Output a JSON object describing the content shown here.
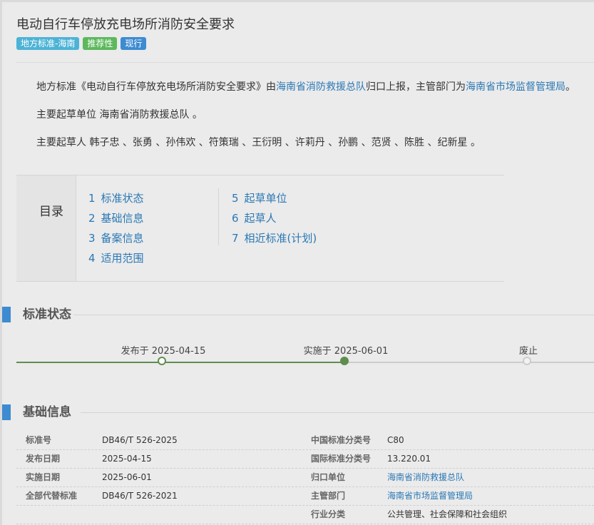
{
  "header": {
    "title": "电动自行车停放充电场所消防安全要求",
    "tags": [
      {
        "label": "地方标准-海南",
        "color": "#4db3d6"
      },
      {
        "label": "推荐性",
        "color": "#5cb85c"
      },
      {
        "label": "现行",
        "color": "#3d8bd1"
      }
    ]
  },
  "intro": {
    "line1_prefix": "地方标准《电动自行车停放充电场所消防安全要求》由",
    "line1_link1": "海南省消防救援总队",
    "line1_mid": "归口上报，主管部门为",
    "line1_link2": "海南省市场监督管理局",
    "line1_suffix": "。",
    "line2": "主要起草单位 海南省消防救援总队 。",
    "line3": "主要起草人 韩子忠 、张勇 、孙伟欢 、符策瑞 、王衍明 、许莉丹 、孙鹏 、范贤 、陈胜 、纪新星 。"
  },
  "toc": {
    "title": "目录",
    "left": [
      {
        "num": "1",
        "label": "标准状态"
      },
      {
        "num": "2",
        "label": "基础信息"
      },
      {
        "num": "3",
        "label": "备案信息"
      },
      {
        "num": "4",
        "label": "适用范围"
      }
    ],
    "right": [
      {
        "num": "5",
        "label": "起草单位"
      },
      {
        "num": "6",
        "label": "起草人"
      },
      {
        "num": "7",
        "label": "相近标准(计划)"
      }
    ]
  },
  "status": {
    "section_title": "标准状态",
    "timeline": [
      {
        "label": "发布于 2025-04-15",
        "state": "done"
      },
      {
        "label": "实施于 2025-06-01",
        "state": "current"
      },
      {
        "label": "废止",
        "state": "pending"
      }
    ],
    "colors": {
      "done": "#5f8d4e",
      "pending": "#cccccc"
    }
  },
  "basic": {
    "section_title": "基础信息",
    "rows": [
      {
        "l_label": "标准号",
        "l_value": "DB46/T 526-2025",
        "r_label": "中国标准分类号",
        "r_value": "C80",
        "r_link": false
      },
      {
        "l_label": "发布日期",
        "l_value": "2025-04-15",
        "r_label": "国际标准分类号",
        "r_value": "13.220.01",
        "r_link": false
      },
      {
        "l_label": "实施日期",
        "l_value": "2025-06-01",
        "r_label": "归口单位",
        "r_value": "海南省消防救援总队",
        "r_link": true
      },
      {
        "l_label": "全部代替标准",
        "l_value": "DB46/T 526-2021",
        "r_label": "主管部门",
        "r_value": "海南省市场监督管理局",
        "r_link": true
      },
      {
        "l_label": "",
        "l_value": "",
        "r_label": "行业分类",
        "r_value": "公共管理、社会保障和社会组织",
        "r_link": false
      }
    ]
  }
}
